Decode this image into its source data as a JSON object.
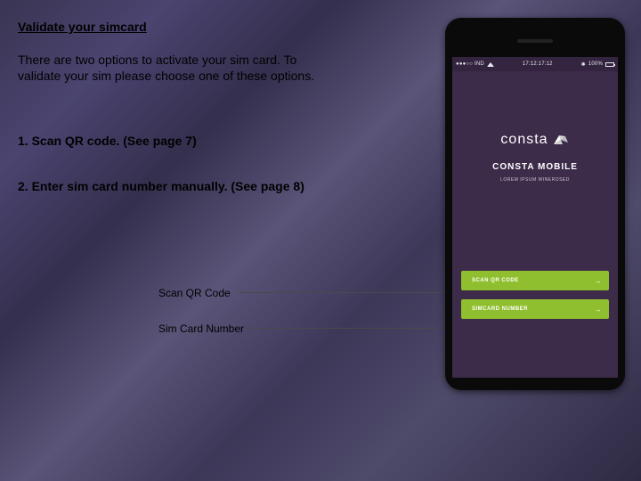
{
  "title": "Validate your simcard",
  "intro": "There are two options to activate your sim card. To validate your sim please choose one of these options.",
  "options": [
    "1. Scan QR code. (See page 7)",
    "2. Enter sim card number manually. (See page 8)"
  ],
  "callouts": {
    "qr": "Scan QR Code",
    "sim": "Sim Card Number"
  },
  "phone": {
    "status": {
      "carrier": "●●●○○ IND",
      "time": "17:12:17:12",
      "battery_pct": "100%"
    },
    "brand": "consta",
    "subbrand": "CONSTA MOBILE",
    "tagline": "LOREM IPSUM WINEROSED",
    "buttons": {
      "scan": "SCAN QR CODE",
      "manual": "SIMCARD NUMBER"
    }
  }
}
